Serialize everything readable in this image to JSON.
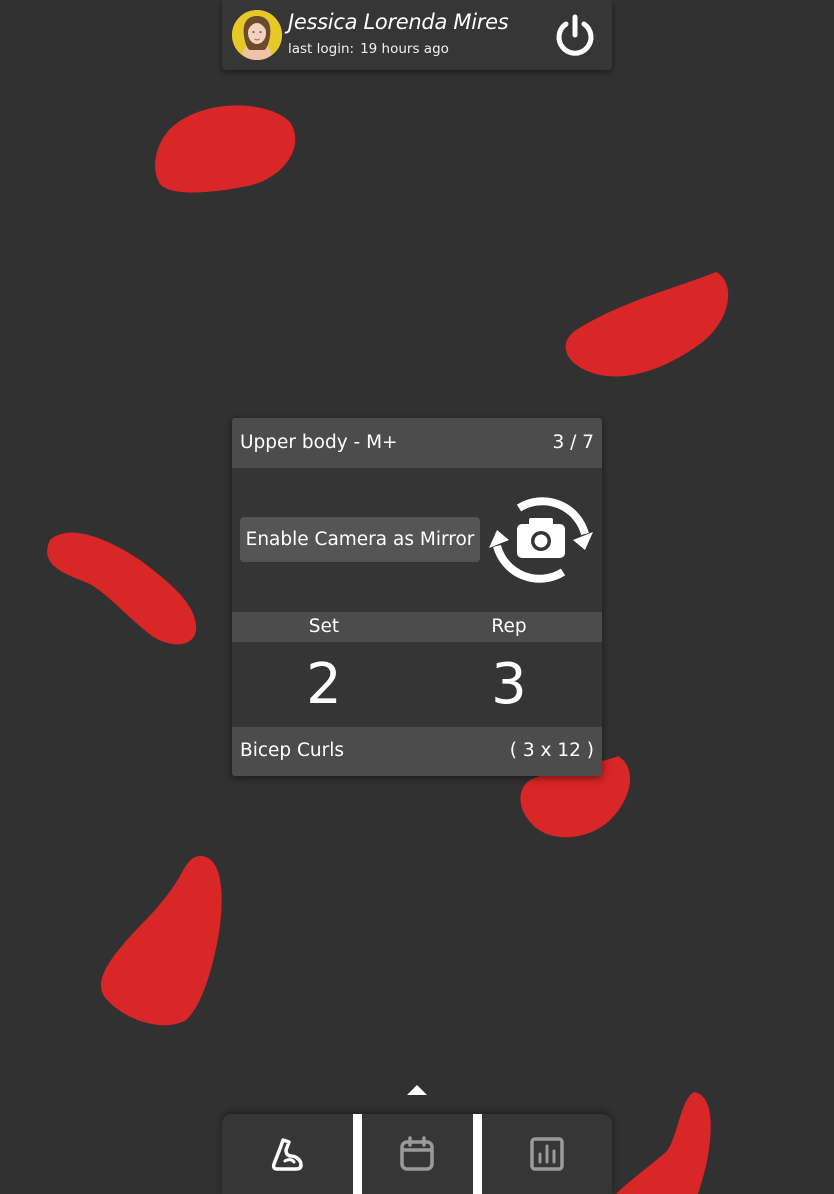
{
  "header": {
    "user_name": "Jessica Lorenda Mires",
    "last_login_label": "last login:",
    "last_login_value": "19 hours ago"
  },
  "workout": {
    "title": "Upper body - M+",
    "progress": "3 / 7",
    "camera_button_label": "Enable Camera as Mirror",
    "set_label": "Set",
    "rep_label": "Rep",
    "set_value": "2",
    "rep_value": "3",
    "exercise_name": "Bicep Curls",
    "scheme": "( 3 x 12 )"
  },
  "icons": {
    "power": "power-icon",
    "camera_switch": "camera-switch-icon",
    "workout_tab": "flexed-arm-icon",
    "calendar_tab": "calendar-icon",
    "stats_tab": "bar-chart-icon",
    "nav_toggle": "caret-up-icon"
  },
  "colors": {
    "background": "#313131",
    "panel": "#353535",
    "panel_header": "#4c4c4c",
    "accent_blob": "#d92626",
    "active_tab_icon": "#ffffff",
    "inactive_tab_icon": "#9a9a9a"
  }
}
